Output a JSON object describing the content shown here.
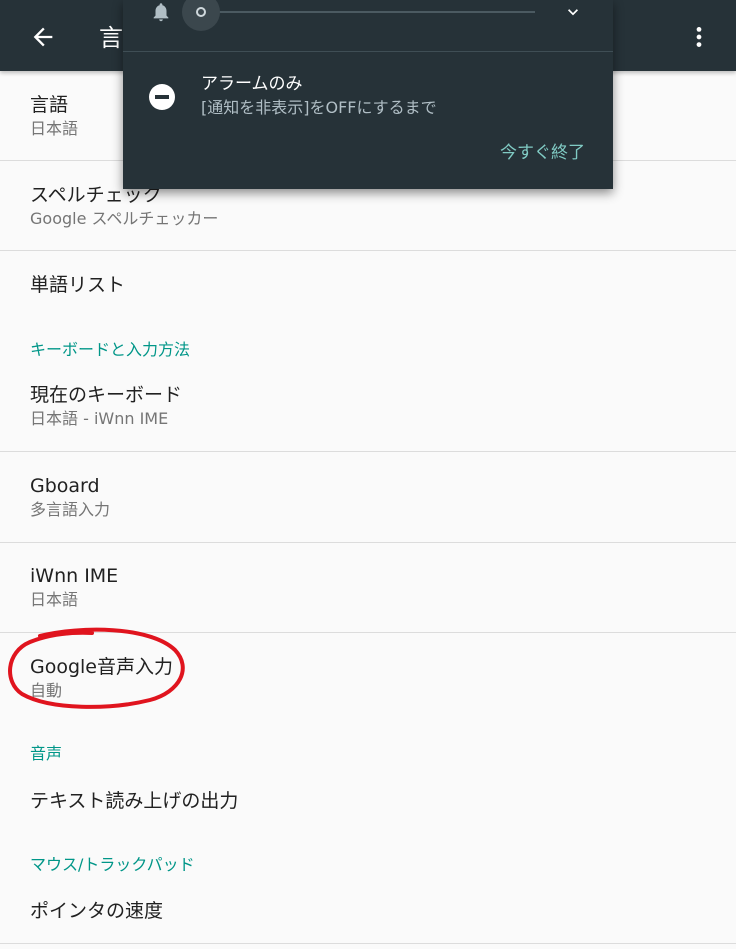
{
  "app_bar": {
    "title": "言語と入力",
    "back_icon": "arrow-back-icon",
    "more_icon": "more-vert-icon",
    "background": "#263238"
  },
  "settings": {
    "language": {
      "title": "言語",
      "summary": "日本語"
    },
    "spell_check": {
      "title": "スペルチェック",
      "summary": "Google スペルチェッカー"
    },
    "word_list": {
      "title": "単語リスト"
    },
    "keyboard_category": "キーボードと入力方法",
    "current_keyboard": {
      "title": "現在のキーボード",
      "summary": "日本語 - iWnn IME"
    },
    "gboard": {
      "title": "Gboard",
      "summary": "多言語入力"
    },
    "iwnn": {
      "title": "iWnn IME",
      "summary": "日本語"
    },
    "google_voice": {
      "title": "Google音声入力",
      "summary": "自動"
    },
    "speech_category": "音声",
    "tts": {
      "title": "テキスト読み上げの出力"
    },
    "mouse_category": "マウス/トラックパッド",
    "pointer_speed": {
      "title": "ポインタの速度"
    },
    "accent_color": "#009688"
  },
  "dnd_panel": {
    "bell_icon": "bell-icon",
    "volume_level": 0,
    "expand_icon": "chevron-down-icon",
    "mode_icon": "do-not-disturb-icon",
    "mode_label": "アラームのみ",
    "mode_detail": "[通知を非表示]をOFFにするまで",
    "end_now": "今すぐ終了",
    "background": "#263238"
  },
  "annotation": {
    "color": "#e0141e"
  }
}
